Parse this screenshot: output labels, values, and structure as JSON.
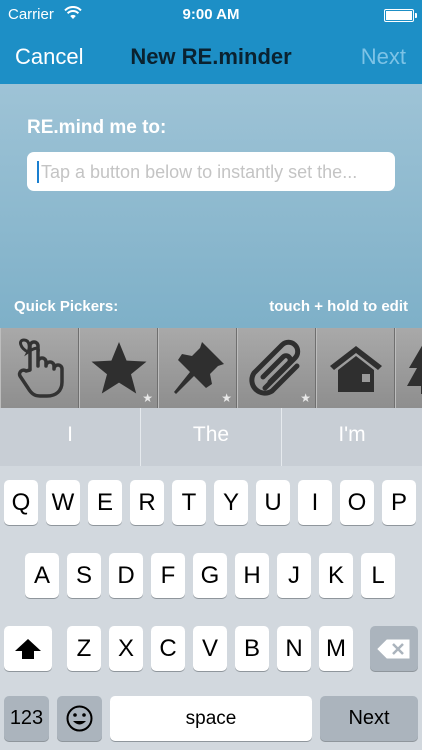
{
  "status_bar": {
    "carrier": "Carrier",
    "time": "9:00 AM"
  },
  "nav": {
    "cancel": "Cancel",
    "title": "New RE.minder",
    "next": "Next"
  },
  "form": {
    "prompt": "RE.mind me to:",
    "placeholder": "Tap a button below to instantly set the..."
  },
  "quick_pickers": {
    "label": "Quick Pickers:",
    "hint": "touch + hold to edit",
    "items": [
      {
        "icon": "finger-string-icon",
        "starred": false
      },
      {
        "icon": "star-icon",
        "starred": true
      },
      {
        "icon": "pushpin-icon",
        "starred": true
      },
      {
        "icon": "paperclip-icon",
        "starred": true
      },
      {
        "icon": "house-icon",
        "starred": false
      },
      {
        "icon": "trees-icon",
        "starred": false
      }
    ]
  },
  "keyboard": {
    "suggestions": [
      "I",
      "The",
      "I'm"
    ],
    "row1": [
      "Q",
      "W",
      "E",
      "R",
      "T",
      "Y",
      "U",
      "I",
      "O",
      "P"
    ],
    "row2": [
      "A",
      "S",
      "D",
      "F",
      "G",
      "H",
      "J",
      "K",
      "L"
    ],
    "row3": [
      "Z",
      "X",
      "C",
      "V",
      "B",
      "N",
      "M"
    ],
    "numbers_key": "123",
    "space_key": "space",
    "return_key": "Next"
  },
  "colors": {
    "nav_blue": "#1d8fc6",
    "content_blue": "#9ec3d6",
    "keyboard_gray": "#d2d8de"
  }
}
